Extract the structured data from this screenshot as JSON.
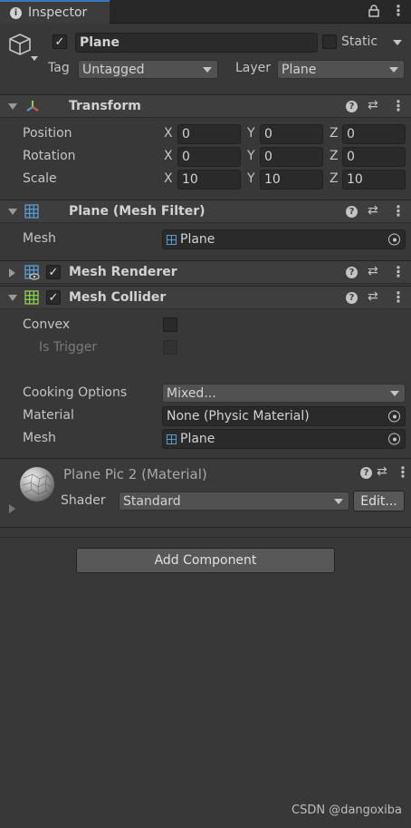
{
  "tab": {
    "title": "Inspector",
    "info_icon": "info-icon",
    "lock_icon": "lock-icon",
    "menu_icon": "kebab-menu-icon"
  },
  "object": {
    "icon": "gameobject-cube-icon",
    "active": true,
    "name": "Plane",
    "static_label": "Static",
    "static_checked": false,
    "tag_label": "Tag",
    "tag_value": "Untagged",
    "layer_label": "Layer",
    "layer_value": "Plane"
  },
  "transform": {
    "title": "Transform",
    "icon": "transform-axes-icon",
    "rows": [
      {
        "label": "Position",
        "x": "0",
        "y": "0",
        "z": "0"
      },
      {
        "label": "Rotation",
        "x": "0",
        "y": "0",
        "z": "0"
      },
      {
        "label": "Scale",
        "x": "10",
        "y": "10",
        "z": "10"
      }
    ],
    "axis_x": "X",
    "axis_y": "Y",
    "axis_z": "Z"
  },
  "mesh_filter": {
    "title": "Plane (Mesh Filter)",
    "icon": "mesh-filter-icon",
    "mesh_label": "Mesh",
    "mesh_value": "Plane"
  },
  "mesh_renderer": {
    "title": "Mesh Renderer",
    "icon": "mesh-renderer-icon",
    "enabled": true
  },
  "mesh_collider": {
    "title": "Mesh Collider",
    "icon": "mesh-collider-icon",
    "enabled": true,
    "convex_label": "Convex",
    "convex_checked": false,
    "is_trigger_label": "Is Trigger",
    "is_trigger_checked": false,
    "cooking_label": "Cooking Options",
    "cooking_value": "Mixed...",
    "material_label": "Material",
    "material_value": "None (Physic Material)",
    "mesh_label": "Mesh",
    "mesh_value": "Plane"
  },
  "material": {
    "title": "Plane Pic 2 (Material)",
    "icon": "material-sphere-icon",
    "shader_label": "Shader",
    "shader_value": "Standard",
    "edit_label": "Edit..."
  },
  "add_component_label": "Add Component",
  "watermark": "CSDN @dangoxiba",
  "colors": {
    "accent": "#3a79bb",
    "background": "#383838",
    "header": "#3e3e3e",
    "field": "#2a2a2a"
  }
}
